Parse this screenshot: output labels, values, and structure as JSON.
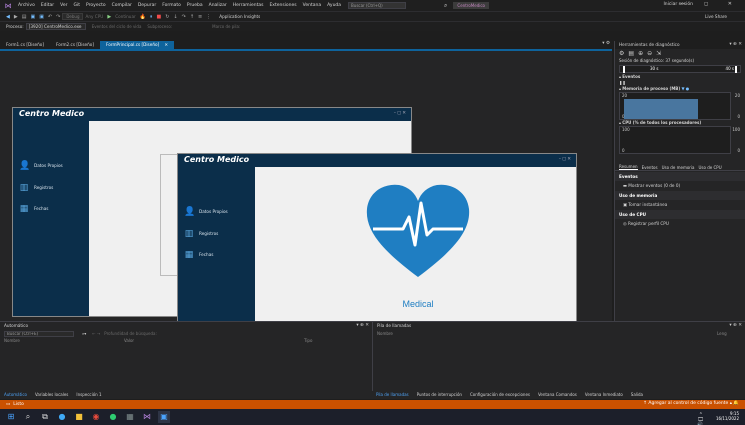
{
  "menubar": {
    "items": [
      "Archivo",
      "Editar",
      "Ver",
      "Git",
      "Proyecto",
      "Compilar",
      "Depurar",
      "Formato",
      "Prueba",
      "Analizar",
      "Herramientas",
      "Extensiones",
      "Ventana",
      "Ayuda"
    ],
    "search_placeholder": "Buscar (Ctrl+Q)",
    "solution_name": "CentroMedico",
    "signin": "Iniciar sesión",
    "window_controls": "— ◻ ✕"
  },
  "toolbar": {
    "config": "Debug",
    "platform": "Any CPU",
    "continue": "Continuar",
    "app_insights": "Application Insights",
    "live_share": "Live Share"
  },
  "procbar": {
    "process_label": "Proceso:",
    "process_value": "[3920] CentroMedico.exe",
    "lifecycle": "Eventos del ciclo de vida",
    "thread": "Subproceso:",
    "stack_frame": "Marco de pila:"
  },
  "doc_tabs": [
    {
      "label": "Form1.cs [Diseño]",
      "active": false
    },
    {
      "label": "Form2.cs [Diseño]",
      "active": false
    },
    {
      "label": "FormPrincipal.cs [Diseño]",
      "active": true
    }
  ],
  "designer": {
    "back_window": {
      "title": "Centro Medico",
      "controls": "–▢✕",
      "items": [
        "Datos Propios",
        "Registros",
        "Fechas"
      ]
    },
    "front_window": {
      "title": "Centro Medico",
      "controls": "–▢✕",
      "items": [
        "Datos Propios",
        "Registros",
        "Fechas"
      ],
      "brand_label": "Medical"
    },
    "colors": {
      "sidebar": "#0b2e4a",
      "heart": "#1f7ec2",
      "form_bg": "#f0f0f0"
    }
  },
  "diagnostics": {
    "title": "Herramientas de diagnóstico",
    "session": "Sesión de diagnóstico: 37 segundo(s)",
    "timeline_labels": [
      "30 s",
      "40 s"
    ],
    "events_label": "Eventos",
    "memory_label": "Memoria de proceso (MB)",
    "memory_ticks": [
      "20",
      "0",
      "20",
      "0"
    ],
    "cpu_label": "CPU (% de todos los procesadores)",
    "cpu_ticks": [
      "100",
      "0",
      "100",
      "0"
    ],
    "tabs": [
      "Resumen",
      "Eventos",
      "Uso de memoria",
      "Uso de CPU"
    ],
    "sections": [
      {
        "header": "Eventos",
        "item": "Mostrar eventos (0 de 0)"
      },
      {
        "header": "Uso de memoria",
        "item": "Tomar instantánea"
      },
      {
        "header": "Uso de CPU",
        "item": "Registrar perfil CPU"
      }
    ]
  },
  "autos": {
    "title": "Automático",
    "search_placeholder": "Buscar (Ctrl+E)",
    "search_depth": "Profundidad de búsqueda:",
    "columns": [
      "Nombre",
      "Valor",
      "Tipo"
    ]
  },
  "callstack": {
    "title": "Pila de llamadas",
    "columns": [
      "Nombre",
      "Leng"
    ]
  },
  "bottom_tabs_left": [
    "Automático",
    "Variables locales",
    "Inspección 1"
  ],
  "bottom_tabs_right": [
    "Pila de llamadas",
    "Puntos de interrupción",
    "Configuración de excepciones",
    "Ventana Comandos",
    "Ventana Inmediato",
    "Salida"
  ],
  "statusbar": {
    "left": "Listo",
    "right": "Agregar al control de código fuente"
  },
  "taskbar": {
    "time": "9:15",
    "date": "16/11/2022"
  }
}
